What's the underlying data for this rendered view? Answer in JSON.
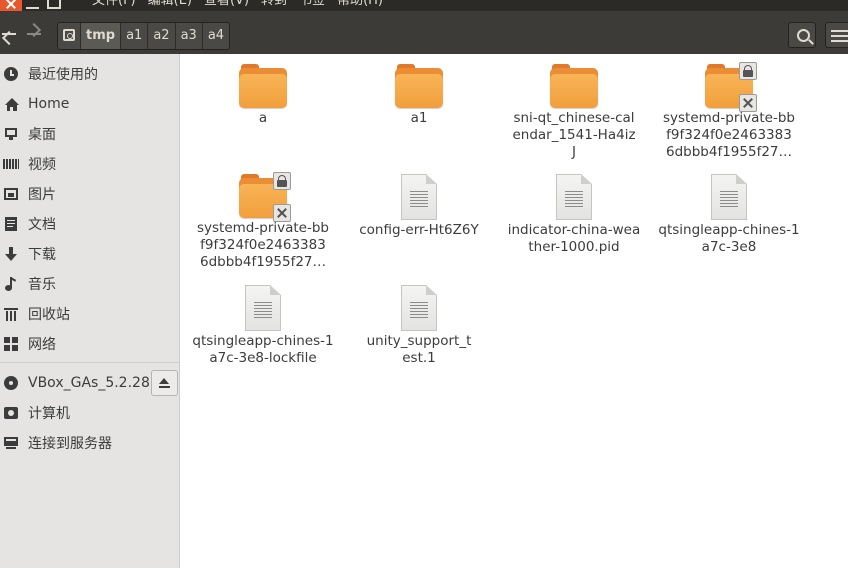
{
  "menubar": {
    "items": [
      "文件(F)",
      "编辑(E)",
      "查看(V)",
      "转到",
      "书签",
      "帮助(H)"
    ]
  },
  "toolbar": {
    "back_icon": "back-arrow-icon",
    "forward_icon": "forward-arrow-icon",
    "path": [
      "tmp",
      "a1",
      "a2",
      "a3",
      "a4"
    ],
    "active_path": "tmp",
    "search_icon": "search-icon",
    "view_icon": "list-view-icon"
  },
  "sidebar": {
    "places": [
      {
        "label": "最近使用的",
        "icon": "recent-icon"
      },
      {
        "label": "Home",
        "icon": "home-icon"
      },
      {
        "label": "桌面",
        "icon": "desktop-icon"
      },
      {
        "label": "视频",
        "icon": "video-icon"
      },
      {
        "label": "图片",
        "icon": "pictures-icon"
      },
      {
        "label": "文档",
        "icon": "documents-icon"
      },
      {
        "label": "下载",
        "icon": "download-icon"
      },
      {
        "label": "音乐",
        "icon": "music-icon"
      },
      {
        "label": "回收站",
        "icon": "trash-icon"
      },
      {
        "label": "网络",
        "icon": "network-icon"
      }
    ],
    "devices": [
      {
        "label": "VBox_GAs_5.2.28",
        "icon": "disc-icon"
      },
      {
        "label": "计算机",
        "icon": "computer-drive-icon"
      },
      {
        "label": "连接到服务器",
        "icon": "server-icon"
      }
    ]
  },
  "files": [
    {
      "name": "a",
      "type": "folder",
      "locked": false
    },
    {
      "name": "a1",
      "type": "folder",
      "locked": false
    },
    {
      "name": "sni-qt_chinese-calendar_1541-Ha4izJ",
      "type": "folder",
      "locked": false
    },
    {
      "name": "systemd-private-bbf9f324f0e24633836dbbb4f1955f27…",
      "type": "folder",
      "locked": true
    },
    {
      "name": "systemd-private-bbf9f324f0e24633836dbbb4f1955f27…",
      "type": "folder",
      "locked": true
    },
    {
      "name": "config-err-Ht6Z6Y",
      "type": "file",
      "locked": false
    },
    {
      "name": "indicator-china-weather-1000.pid",
      "type": "file",
      "locked": false
    },
    {
      "name": "qtsingleapp-chines-1a7c-3e8",
      "type": "file",
      "locked": false
    },
    {
      "name": "qtsingleapp-chines-1a7c-3e8-lockfile",
      "type": "file",
      "locked": false
    },
    {
      "name": "unity_support_test.1",
      "type": "file",
      "locked": false
    }
  ],
  "colors": {
    "accent": "#e8582c",
    "folder": "#f5a947",
    "toolbar": "#3c3b37",
    "sidebar": "#e5e4e2"
  }
}
